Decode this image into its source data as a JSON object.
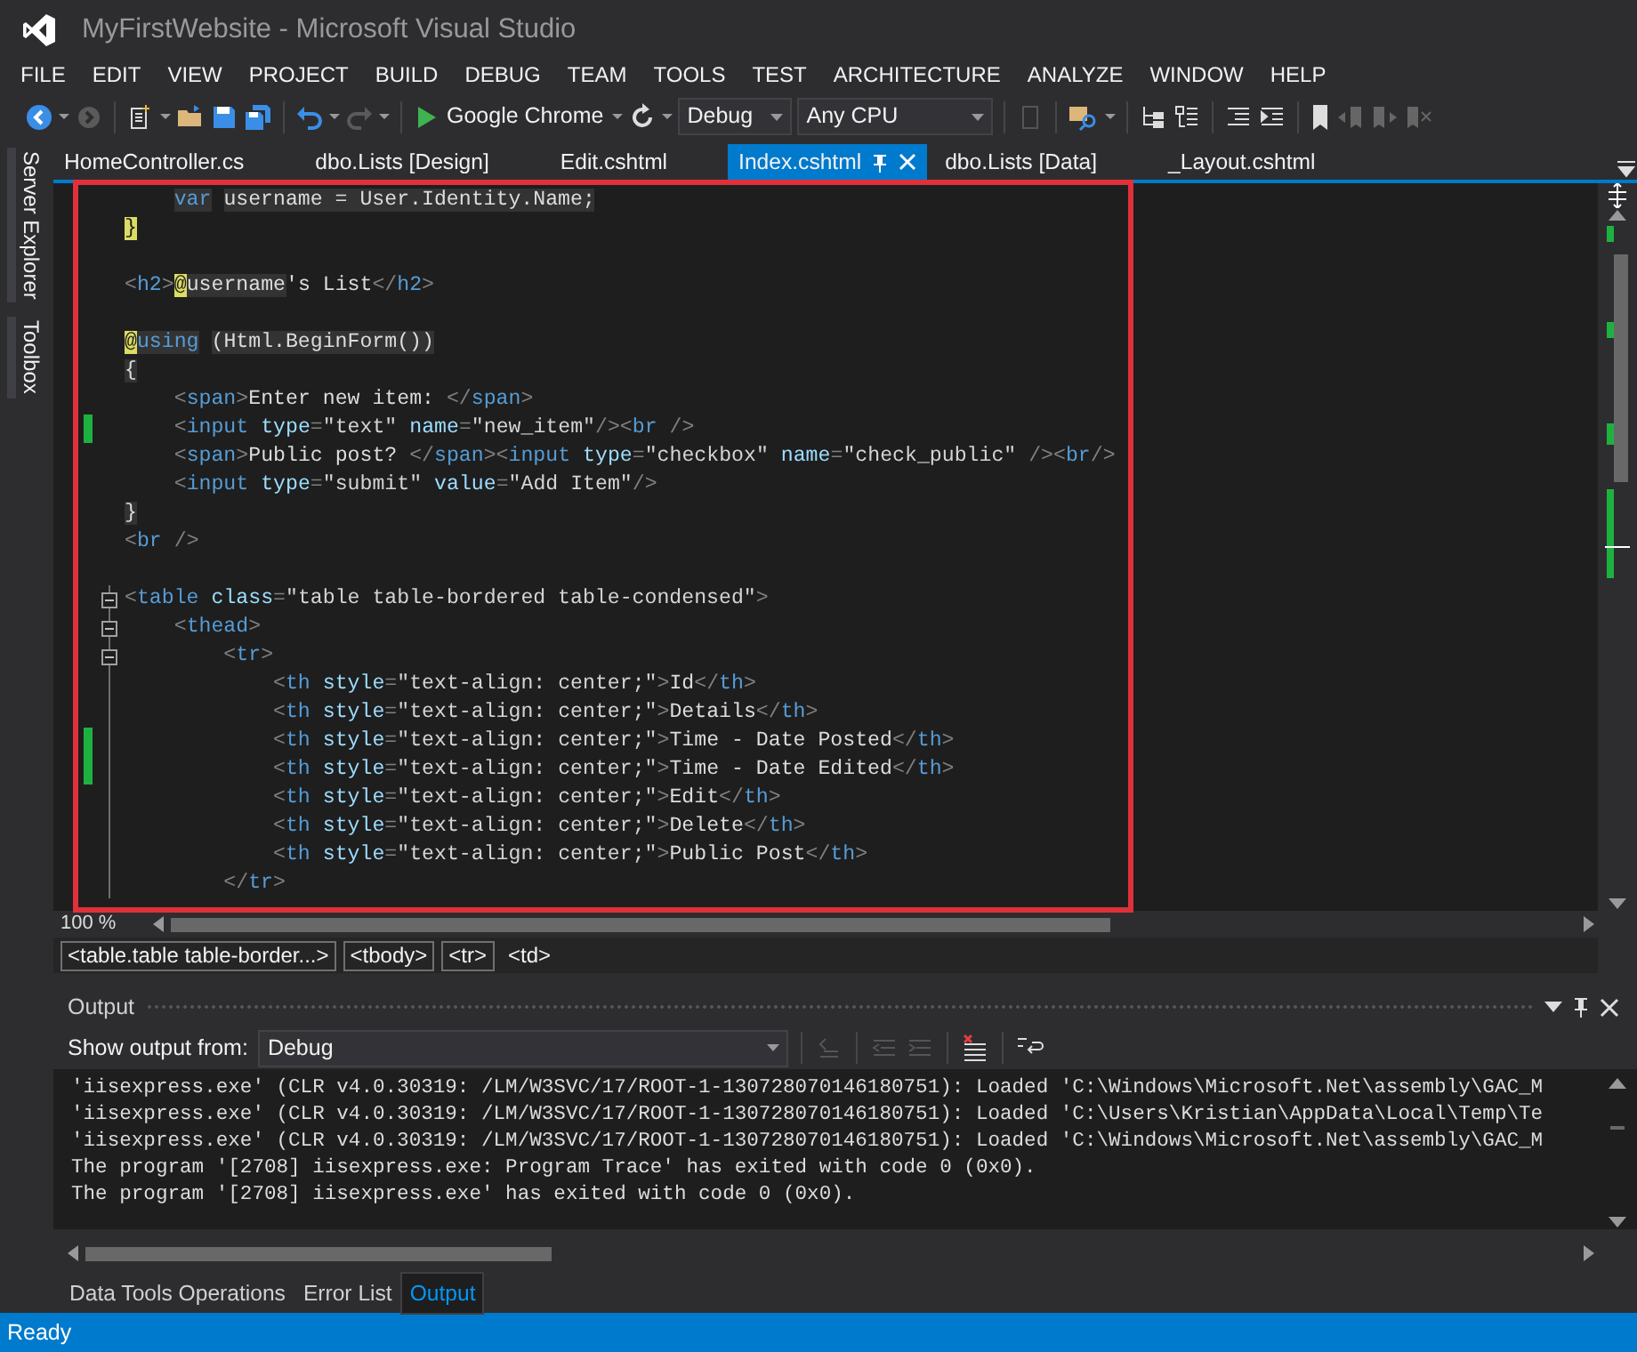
{
  "window": {
    "title": "MyFirstWebsite - Microsoft Visual Studio"
  },
  "menu": [
    "FILE",
    "EDIT",
    "VIEW",
    "PROJECT",
    "BUILD",
    "DEBUG",
    "TEAM",
    "TOOLS",
    "TEST",
    "ARCHITECTURE",
    "ANALYZE",
    "WINDOW",
    "HELP"
  ],
  "toolbar": {
    "run_target": "Google Chrome",
    "configuration": "Debug",
    "platform": "Any CPU"
  },
  "side_tabs": [
    "Server Explorer",
    "Toolbox"
  ],
  "doc_tabs": [
    {
      "label": "HomeController.cs",
      "selected": false
    },
    {
      "label": "dbo.Lists [Design]",
      "selected": false
    },
    {
      "label": "Edit.cshtml",
      "selected": false
    },
    {
      "label": "Index.cshtml",
      "selected": true
    },
    {
      "label": "dbo.Lists [Data]",
      "selected": false
    },
    {
      "label": "_Layout.cshtml",
      "selected": false
    }
  ],
  "editor": {
    "annotation": {
      "kind": "rectangle",
      "color": "#e0303a"
    },
    "lines": [
      {
        "kind": "code",
        "changed": false,
        "fold": false,
        "tokens": [
          {
            "kind": "code-keyword",
            "text": "    var"
          },
          {
            "kind": "code",
            "text": " username = User.Identity.Name;"
          }
        ]
      },
      {
        "kind": "code",
        "changed": false,
        "fold": false,
        "tokens": [
          {
            "kind": "razor",
            "text": "}"
          }
        ]
      },
      {
        "kind": "blank"
      },
      {
        "kind": "code",
        "changed": false,
        "fold": false,
        "tokens": [
          {
            "kind": "delim",
            "text": "<"
          },
          {
            "kind": "tag",
            "text": "h2"
          },
          {
            "kind": "delim",
            "text": ">"
          },
          {
            "kind": "razor",
            "text": "@"
          },
          {
            "kind": "code",
            "text": "username"
          },
          {
            "kind": "text",
            "text": "'s List"
          },
          {
            "kind": "delim",
            "text": "</"
          },
          {
            "kind": "tag",
            "text": "h2"
          },
          {
            "kind": "delim",
            "text": ">"
          }
        ]
      },
      {
        "kind": "blank"
      },
      {
        "kind": "code",
        "changed": false,
        "fold": false,
        "tokens": [
          {
            "kind": "razor",
            "text": "@"
          },
          {
            "kind": "code-keyword",
            "text": "using"
          },
          {
            "kind": "code",
            "text": " (Html.BeginForm())"
          }
        ]
      },
      {
        "kind": "code",
        "changed": false,
        "fold": false,
        "tokens": [
          {
            "kind": "code",
            "text": "{"
          }
        ]
      },
      {
        "kind": "code",
        "changed": false,
        "fold": false,
        "tokens": [
          {
            "kind": "delim",
            "text": "    <"
          },
          {
            "kind": "tag",
            "text": "span"
          },
          {
            "kind": "delim",
            "text": ">"
          },
          {
            "kind": "text",
            "text": "Enter new item: "
          },
          {
            "kind": "delim",
            "text": "</"
          },
          {
            "kind": "tag",
            "text": "span"
          },
          {
            "kind": "delim",
            "text": ">"
          }
        ]
      },
      {
        "kind": "code",
        "changed": true,
        "fold": false,
        "tokens": [
          {
            "kind": "delim",
            "text": "    <"
          },
          {
            "kind": "tag",
            "text": "input"
          },
          {
            "kind": "attr",
            "text": " type"
          },
          {
            "kind": "delim",
            "text": "="
          },
          {
            "kind": "value",
            "text": "\"text\""
          },
          {
            "kind": "attr",
            "text": " name"
          },
          {
            "kind": "delim",
            "text": "="
          },
          {
            "kind": "value",
            "text": "\"new_item\""
          },
          {
            "kind": "delim",
            "text": "/><"
          },
          {
            "kind": "tag",
            "text": "br"
          },
          {
            "kind": "delim",
            "text": " />"
          }
        ]
      },
      {
        "kind": "code",
        "changed": false,
        "fold": false,
        "tokens": [
          {
            "kind": "delim",
            "text": "    <"
          },
          {
            "kind": "tag",
            "text": "span"
          },
          {
            "kind": "delim",
            "text": ">"
          },
          {
            "kind": "text",
            "text": "Public post? "
          },
          {
            "kind": "delim",
            "text": "</"
          },
          {
            "kind": "tag",
            "text": "span"
          },
          {
            "kind": "delim",
            "text": "><"
          },
          {
            "kind": "tag",
            "text": "input"
          },
          {
            "kind": "attr",
            "text": " type"
          },
          {
            "kind": "delim",
            "text": "="
          },
          {
            "kind": "value",
            "text": "\"checkbox\""
          },
          {
            "kind": "attr",
            "text": " name"
          },
          {
            "kind": "delim",
            "text": "="
          },
          {
            "kind": "value",
            "text": "\"check_public\""
          },
          {
            "kind": "delim",
            "text": " /><"
          },
          {
            "kind": "tag",
            "text": "br"
          },
          {
            "kind": "delim",
            "text": "/>"
          }
        ]
      },
      {
        "kind": "code",
        "changed": false,
        "fold": false,
        "tokens": [
          {
            "kind": "delim",
            "text": "    <"
          },
          {
            "kind": "tag",
            "text": "input"
          },
          {
            "kind": "attr",
            "text": " type"
          },
          {
            "kind": "delim",
            "text": "="
          },
          {
            "kind": "value",
            "text": "\"submit\""
          },
          {
            "kind": "attr",
            "text": " value"
          },
          {
            "kind": "delim",
            "text": "="
          },
          {
            "kind": "value",
            "text": "\"Add Item\""
          },
          {
            "kind": "delim",
            "text": "/>"
          }
        ]
      },
      {
        "kind": "code",
        "changed": false,
        "fold": false,
        "tokens": [
          {
            "kind": "code",
            "text": "}"
          }
        ]
      },
      {
        "kind": "code",
        "changed": false,
        "fold": false,
        "tokens": [
          {
            "kind": "delim",
            "text": "<"
          },
          {
            "kind": "tag",
            "text": "br"
          },
          {
            "kind": "delim",
            "text": " />"
          }
        ]
      },
      {
        "kind": "blank"
      },
      {
        "kind": "code",
        "changed": false,
        "fold": true,
        "tokens": [
          {
            "kind": "delim",
            "text": "<"
          },
          {
            "kind": "tag",
            "text": "table"
          },
          {
            "kind": "attr",
            "text": " class"
          },
          {
            "kind": "delim",
            "text": "="
          },
          {
            "kind": "value",
            "text": "\"table table-bordered table-condensed\""
          },
          {
            "kind": "delim",
            "text": ">"
          }
        ]
      },
      {
        "kind": "code",
        "changed": false,
        "fold": true,
        "tokens": [
          {
            "kind": "delim",
            "text": "    <"
          },
          {
            "kind": "tag",
            "text": "thead"
          },
          {
            "kind": "delim",
            "text": ">"
          }
        ]
      },
      {
        "kind": "code",
        "changed": false,
        "fold": true,
        "tokens": [
          {
            "kind": "delim",
            "text": "        <"
          },
          {
            "kind": "tag",
            "text": "tr"
          },
          {
            "kind": "delim",
            "text": ">"
          }
        ]
      },
      {
        "kind": "code",
        "changed": false,
        "fold": false,
        "tokens": [
          {
            "kind": "delim",
            "text": "            <"
          },
          {
            "kind": "tag",
            "text": "th"
          },
          {
            "kind": "attr",
            "text": " style"
          },
          {
            "kind": "delim",
            "text": "="
          },
          {
            "kind": "value",
            "text": "\"text-align: center;\""
          },
          {
            "kind": "delim",
            "text": ">"
          },
          {
            "kind": "text",
            "text": "Id"
          },
          {
            "kind": "delim",
            "text": "</"
          },
          {
            "kind": "tag",
            "text": "th"
          },
          {
            "kind": "delim",
            "text": ">"
          }
        ]
      },
      {
        "kind": "code",
        "changed": false,
        "fold": false,
        "tokens": [
          {
            "kind": "delim",
            "text": "            <"
          },
          {
            "kind": "tag",
            "text": "th"
          },
          {
            "kind": "attr",
            "text": " style"
          },
          {
            "kind": "delim",
            "text": "="
          },
          {
            "kind": "value",
            "text": "\"text-align: center;\""
          },
          {
            "kind": "delim",
            "text": ">"
          },
          {
            "kind": "text",
            "text": "Details"
          },
          {
            "kind": "delim",
            "text": "</"
          },
          {
            "kind": "tag",
            "text": "th"
          },
          {
            "kind": "delim",
            "text": ">"
          }
        ]
      },
      {
        "kind": "code",
        "changed": true,
        "fold": false,
        "tokens": [
          {
            "kind": "delim",
            "text": "            <"
          },
          {
            "kind": "tag",
            "text": "th"
          },
          {
            "kind": "attr",
            "text": " style"
          },
          {
            "kind": "delim",
            "text": "="
          },
          {
            "kind": "value",
            "text": "\"text-align: center;\""
          },
          {
            "kind": "delim",
            "text": ">"
          },
          {
            "kind": "text",
            "text": "Time - Date Posted"
          },
          {
            "kind": "delim",
            "text": "</"
          },
          {
            "kind": "tag",
            "text": "th"
          },
          {
            "kind": "delim",
            "text": ">"
          }
        ]
      },
      {
        "kind": "code",
        "changed": true,
        "fold": false,
        "tokens": [
          {
            "kind": "delim",
            "text": "            <"
          },
          {
            "kind": "tag",
            "text": "th"
          },
          {
            "kind": "attr",
            "text": " style"
          },
          {
            "kind": "delim",
            "text": "="
          },
          {
            "kind": "value",
            "text": "\"text-align: center;\""
          },
          {
            "kind": "delim",
            "text": ">"
          },
          {
            "kind": "text",
            "text": "Time - Date Edited"
          },
          {
            "kind": "delim",
            "text": "</"
          },
          {
            "kind": "tag",
            "text": "th"
          },
          {
            "kind": "delim",
            "text": ">"
          }
        ]
      },
      {
        "kind": "code",
        "changed": false,
        "fold": false,
        "tokens": [
          {
            "kind": "delim",
            "text": "            <"
          },
          {
            "kind": "tag",
            "text": "th"
          },
          {
            "kind": "attr",
            "text": " style"
          },
          {
            "kind": "delim",
            "text": "="
          },
          {
            "kind": "value",
            "text": "\"text-align: center;\""
          },
          {
            "kind": "delim",
            "text": ">"
          },
          {
            "kind": "text",
            "text": "Edit"
          },
          {
            "kind": "delim",
            "text": "</"
          },
          {
            "kind": "tag",
            "text": "th"
          },
          {
            "kind": "delim",
            "text": ">"
          }
        ]
      },
      {
        "kind": "code",
        "changed": false,
        "fold": false,
        "tokens": [
          {
            "kind": "delim",
            "text": "            <"
          },
          {
            "kind": "tag",
            "text": "th"
          },
          {
            "kind": "attr",
            "text": " style"
          },
          {
            "kind": "delim",
            "text": "="
          },
          {
            "kind": "value",
            "text": "\"text-align: center;\""
          },
          {
            "kind": "delim",
            "text": ">"
          },
          {
            "kind": "text",
            "text": "Delete"
          },
          {
            "kind": "delim",
            "text": "</"
          },
          {
            "kind": "tag",
            "text": "th"
          },
          {
            "kind": "delim",
            "text": ">"
          }
        ]
      },
      {
        "kind": "code",
        "changed": false,
        "fold": false,
        "tokens": [
          {
            "kind": "delim",
            "text": "            <"
          },
          {
            "kind": "tag",
            "text": "th"
          },
          {
            "kind": "attr",
            "text": " style"
          },
          {
            "kind": "delim",
            "text": "="
          },
          {
            "kind": "value",
            "text": "\"text-align: center;\""
          },
          {
            "kind": "delim",
            "text": ">"
          },
          {
            "kind": "text",
            "text": "Public Post"
          },
          {
            "kind": "delim",
            "text": "</"
          },
          {
            "kind": "tag",
            "text": "th"
          },
          {
            "kind": "delim",
            "text": ">"
          }
        ]
      },
      {
        "kind": "code",
        "changed": false,
        "fold": false,
        "tokens": [
          {
            "kind": "delim",
            "text": "        </"
          },
          {
            "kind": "tag",
            "text": "tr"
          },
          {
            "kind": "delim",
            "text": ">"
          }
        ]
      }
    ],
    "zoom": "100 %"
  },
  "breadcrumbs": [
    {
      "label": "<table.table table-border...>",
      "selected": false
    },
    {
      "label": "<tbody>",
      "selected": false
    },
    {
      "label": "<tr>",
      "selected": false
    },
    {
      "label": "<td>",
      "selected": true
    }
  ],
  "output": {
    "title": "Output",
    "source_label": "Show output from:",
    "source": "Debug",
    "lines": [
      "'iisexpress.exe' (CLR v4.0.30319: /LM/W3SVC/17/ROOT-1-130728070146180751): Loaded 'C:\\Windows\\Microsoft.Net\\assembly\\GAC_M",
      "'iisexpress.exe' (CLR v4.0.30319: /LM/W3SVC/17/ROOT-1-130728070146180751): Loaded 'C:\\Users\\Kristian\\AppData\\Local\\Temp\\Te",
      "'iisexpress.exe' (CLR v4.0.30319: /LM/W3SVC/17/ROOT-1-130728070146180751): Loaded 'C:\\Windows\\Microsoft.Net\\assembly\\GAC_M",
      "The program '[2708] iisexpress.exe: Program Trace' has exited with code 0 (0x0).",
      "The program '[2708] iisexpress.exe' has exited with code 0 (0x0)."
    ]
  },
  "bottom_tabs": [
    {
      "label": "Data Tools Operations",
      "selected": false
    },
    {
      "label": "Error List",
      "selected": false
    },
    {
      "label": "Output",
      "selected": true
    }
  ],
  "status_bar": {
    "text": "Ready"
  }
}
